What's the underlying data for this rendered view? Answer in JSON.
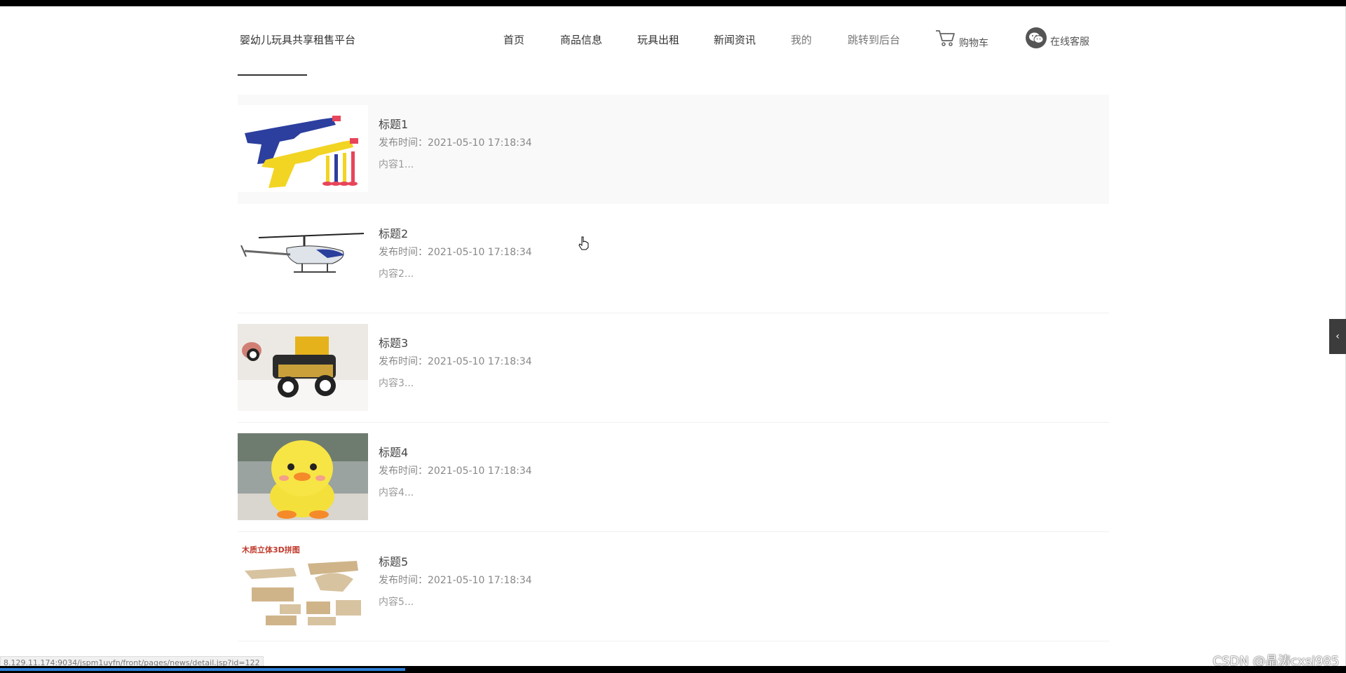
{
  "header": {
    "site_title": "婴幼儿玩具共享租售平台",
    "nav": [
      {
        "label": "首页"
      },
      {
        "label": "商品信息"
      },
      {
        "label": "玩具出租"
      },
      {
        "label": "新闻资讯"
      },
      {
        "label": "我的"
      },
      {
        "label": "跳转到后台"
      }
    ],
    "cart_label": "购物车",
    "service_label": "在线客服"
  },
  "news": [
    {
      "title": "标题1",
      "date_label": "发布时间：",
      "date": "2021-05-10 17:18:34",
      "excerpt": "内容1...",
      "image": "toy-guns"
    },
    {
      "title": "标题2",
      "date_label": "发布时间：",
      "date": "2021-05-10 17:18:34",
      "excerpt": "内容2...",
      "image": "toy-helicopter"
    },
    {
      "title": "标题3",
      "date_label": "发布时间：",
      "date": "2021-05-10 17:18:34",
      "excerpt": "内容3...",
      "image": "toy-car"
    },
    {
      "title": "标题4",
      "date_label": "发布时间：",
      "date": "2021-05-10 17:18:34",
      "excerpt": "内容4...",
      "image": "toy-duck"
    },
    {
      "title": "标题5",
      "date_label": "发布时间：",
      "date": "2021-05-10 17:18:34",
      "excerpt": "内容5...",
      "image": "wooden-puzzle",
      "image_caption": "木质立体3D拼图"
    }
  ],
  "status_url": "8.129.11.174:9034/jspm1uyfn/front/pages/news/detail.jsp?id=122",
  "watermark": "CSDN @晶涛cxsj985",
  "colors": {
    "accent_underline": "#333333",
    "hover_row": "#f9f9f9",
    "side_toggle": "#3c3c3c"
  }
}
